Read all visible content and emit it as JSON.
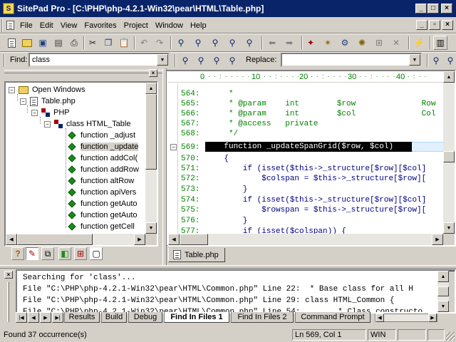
{
  "window": {
    "title": "SitePad Pro - [C:\\PHP\\php-4.2.1-Win32\\pear\\HTML\\Table.php]"
  },
  "menu": [
    "File",
    "Edit",
    "View",
    "Favorites",
    "Project",
    "Window",
    "Help"
  ],
  "findbar": {
    "find_label": "Find:",
    "find_value": "class",
    "replace_label": "Replace:",
    "replace_value": ""
  },
  "tree": {
    "items": [
      {
        "label": "Open Windows"
      },
      {
        "label": "Table.php"
      },
      {
        "label": "PHP"
      },
      {
        "label": "class HTML_Table"
      },
      {
        "label": "function _adjust"
      },
      {
        "label": "function _update"
      },
      {
        "label": "function addCol("
      },
      {
        "label": "function addRow"
      },
      {
        "label": "function altRow"
      },
      {
        "label": "function apiVers"
      },
      {
        "label": "function getAuto"
      },
      {
        "label": "function getAuto"
      },
      {
        "label": "function getCell"
      }
    ]
  },
  "ruler": {
    "marks": [
      "0",
      "10",
      "20",
      "30",
      "40"
    ]
  },
  "editor": {
    "lines": [
      {
        "num": "564:",
        "text": "     *"
      },
      {
        "num": "565:",
        "text": "     * @param    int        $row              Row"
      },
      {
        "num": "566:",
        "text": "     * @param    int        $col              Col"
      },
      {
        "num": "567:",
        "text": "     * @access   private"
      },
      {
        "num": "568:",
        "text": "     */"
      },
      {
        "num": "569:",
        "text": "    function _updateSpanGrid($row, $col)"
      },
      {
        "num": "570:",
        "text": "    {"
      },
      {
        "num": "571:",
        "text": "        if (isset($this->_structure[$row][$col]"
      },
      {
        "num": "572:",
        "text": "            $colspan = $this->_structure[$row]["
      },
      {
        "num": "573:",
        "text": "        }"
      },
      {
        "num": "574:",
        "text": "        if (isset($this->_structure[$row][$col]"
      },
      {
        "num": "575:",
        "text": "            $rowspan = $this->_structure[$row]["
      },
      {
        "num": "576:",
        "text": "        }"
      },
      {
        "num": "577:",
        "text": "        if (isset($colspan)) {"
      }
    ],
    "file_tab": "Table.php"
  },
  "output": {
    "lines": [
      "Searching for 'class'...",
      "File \"C:\\PHP\\php-4.2.1-Win32\\pear\\HTML\\Common.php\" Line 22:  * Base class for all H",
      "File \"C:\\PHP\\php-4.2.1-Win32\\pear\\HTML\\Common.php\" Line 29: class HTML_Common {",
      "File \"C:\\PHP\\php-4.2.1-Win32\\pear\\HTML\\Common.php\" Line 54:        * Class constructo"
    ],
    "tabs": [
      "Results",
      "Build",
      "Debug",
      "Find In Files 1",
      "Find In Files 2",
      "Command Prompt"
    ],
    "active_tab": "Find In Files 1"
  },
  "status": {
    "message": "Found 37 occurrence(s)",
    "position": "Ln 569, Col 1",
    "os": "WIN"
  }
}
